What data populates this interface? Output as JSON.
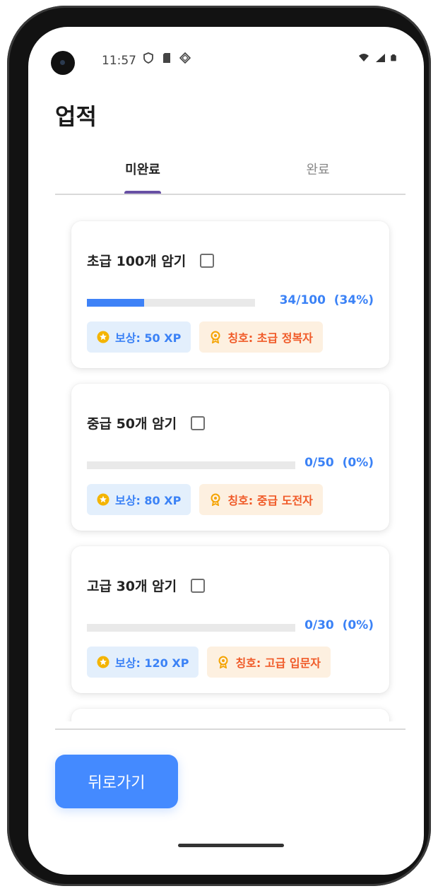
{
  "status_bar": {
    "time": "11:57"
  },
  "page": {
    "title": "업적"
  },
  "tabs": [
    {
      "label": "미완료",
      "active": true
    },
    {
      "label": "완료",
      "active": false
    }
  ],
  "achievements": [
    {
      "title": "초급 100개 암기",
      "progress_text": "34/100  (34%)",
      "progress": 0.34,
      "reward": "보상: 50 XP",
      "honor": "칭호: 초급 정복자"
    },
    {
      "title": "중급 50개 암기",
      "progress_text": "0/50  (0%)",
      "progress": 0.0,
      "reward": "보상: 80 XP",
      "honor": "칭호: 중급 도전자"
    },
    {
      "title": "고급 30개 암기",
      "progress_text": "0/30  (0%)",
      "progress": 0.0,
      "reward": "보상: 120 XP",
      "honor": "칭호: 고급 입문자"
    }
  ],
  "footer": {
    "back_label": "뒤로가기"
  },
  "colors": {
    "accent": "#448aff",
    "tab_indicator": "#6750a4",
    "progress": "#3e82f7",
    "reward_text": "#3b82f6",
    "honor_text": "#f05a28"
  },
  "icons": {
    "reward": "star-circle-icon",
    "honor": "award-ribbon-icon"
  }
}
